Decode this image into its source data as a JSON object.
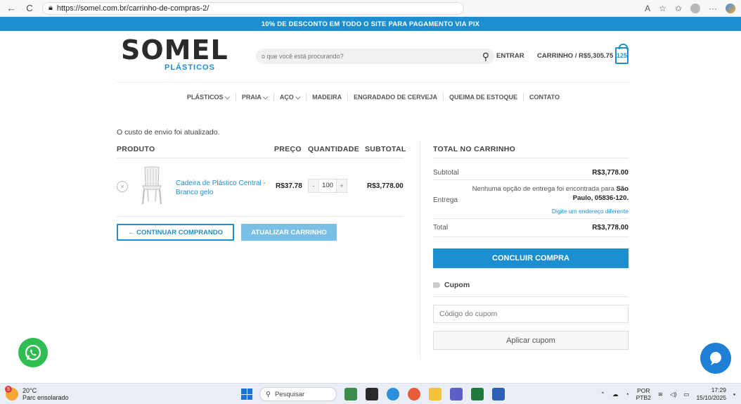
{
  "browser": {
    "url": "https://somel.com.br/carrinho-de-compras-2/",
    "read_aloud": "A",
    "back_icon": "←",
    "reload_icon": "C",
    "more_icon": "···"
  },
  "promo": {
    "text": "10% DE DESCONTO EM TODO O SITE PARA PAGAMENTO VIA PIX"
  },
  "header": {
    "logo_text": "SOMEL",
    "logo_sub": "PLÁSTICOS",
    "search_placeholder": "o que você está procurando?",
    "login_label": "ENTRAR",
    "cart_label": "CARRINHO / R$5,305.75",
    "cart_count": "125"
  },
  "nav": {
    "items": [
      {
        "label": "PLÁSTICOS ⌵"
      },
      {
        "label": "PRAIA ⌵"
      },
      {
        "label": "AÇO ⌵"
      },
      {
        "label": "MADEIRA"
      },
      {
        "label": "ENGRADADO DE CERVEJA"
      },
      {
        "label": "QUEIMA DE ESTOQUE"
      },
      {
        "label": "CONTATO"
      }
    ]
  },
  "cart": {
    "notice": "O custo de envio foi atualizado.",
    "headers": {
      "product": "PRODUTO",
      "price": "PREÇO",
      "quantity": "QUANTIDADE",
      "subtotal": "SUBTOTAL"
    },
    "item": {
      "remove": "×",
      "name": "Cadeira de Plástico Central - Branco gelo",
      "price": "R$37.78",
      "qty_minus": "-",
      "qty": "100",
      "qty_plus": "+",
      "subtotal": "R$3,778.00"
    },
    "continue_label": "← CONTINUAR COMPRANDO",
    "update_label": "ATUALIZAR CARRINHO"
  },
  "totals": {
    "title": "TOTAL NO CARRINHO",
    "subtotal_label": "Subtotal",
    "subtotal_value": "R$3,778.00",
    "shipping_label": "Entrega",
    "shipping_msg": "Nenhuma opção de entrega foi encontrada para",
    "shipping_place": "São Paulo, 05836-120.",
    "shipping_link": "Digite um endereço diferente",
    "total_label": "Total",
    "total_value": "R$3,778.00",
    "checkout_label": "CONCLUIR COMPRA",
    "coupon_title": "Cupom",
    "coupon_placeholder": "Código do cupom",
    "coupon_button": "Aplicar cupom"
  },
  "taskbar": {
    "weather_temp": "20°C",
    "weather_desc": "Parc ensolarado",
    "weather_badge": "5",
    "search_label": "Pesquisar",
    "lang1": "POR",
    "lang2": "PTB2",
    "time": "17:29",
    "date": "15/10/2025"
  },
  "colors": {
    "accent": "#1d8fd0",
    "whatsapp": "#2fbd52"
  }
}
